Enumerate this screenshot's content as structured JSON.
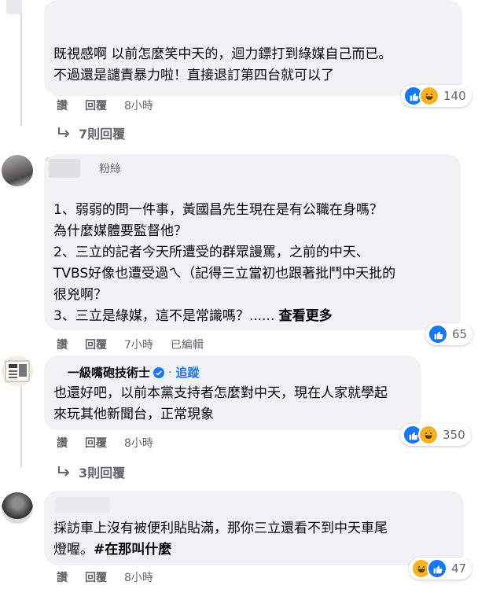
{
  "comments": [
    {
      "text": "既視感啊 以前怎麼笑中天的，迴力鏢打到綠媒自己而已。\n不過還是譴責暴力啦！直接退訂第四台就可以了",
      "actions": [
        "讚",
        "回覆"
      ],
      "time": "8小時",
      "reactions": {
        "icons": [
          "like-icon",
          "haha-icon"
        ],
        "count": "140"
      },
      "replies_link": "7則回覆"
    },
    {
      "badge": "粉絲",
      "text": "1、弱弱的問一件事，黃國昌先生現在是有公職在身嗎？\n為什麼媒體要監督他？\n2、三立的記者今天所遭受的群眾謾罵，之前的中天、\nTVBS好像也遭受過ㄟ（記得三立當初也跟著批鬥中天批的\n很兇啊？\n3、三立是綠媒，這不是常識嗎？......",
      "see_more": "查看更多",
      "actions": [
        "讚",
        "回覆"
      ],
      "time": "7小時",
      "edited": "已編輯",
      "reactions": {
        "icons": [
          "like-icon"
        ],
        "count": "65"
      }
    },
    {
      "name": "一級嘴砲技術士",
      "follow": "追蹤",
      "text": "也還好吧，以前本黨支持者怎麼對中天，現在人家就學起\n來玩其他新聞台，正常現象",
      "actions": [
        "讚",
        "回覆"
      ],
      "time": "8小時",
      "reactions": {
        "icons": [
          "like-icon",
          "haha-icon"
        ],
        "count": "350"
      },
      "replies_link": "3則回覆"
    },
    {
      "text": "採訪車上沒有被便利貼貼滿，那你三立還看不到中天車尾\n燈喔。",
      "hashtag": "#在那叫什麼",
      "actions": [
        "讚",
        "回覆"
      ],
      "time": "8小時",
      "reactions": {
        "icons": [
          "haha-icon",
          "like-icon"
        ],
        "count": "47"
      }
    }
  ],
  "colors": {
    "like": "#1877f2",
    "haha": "#f7b125",
    "verified": "#1877f2",
    "bubble": "#f0f2f5",
    "meta": "#65676b"
  }
}
